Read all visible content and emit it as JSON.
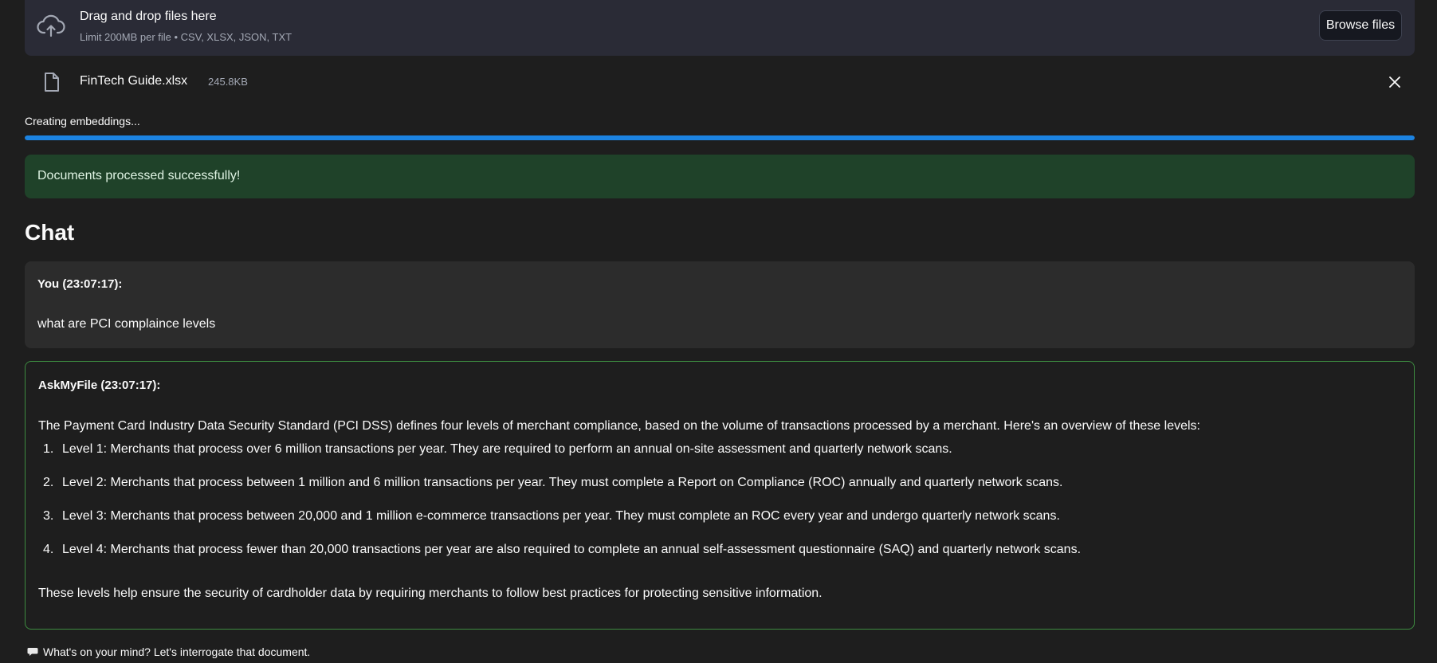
{
  "uploader": {
    "title": "Drag and drop files here",
    "limit": "Limit 200MB per file • CSV, XLSX, JSON, TXT",
    "browse_label": "Browse files",
    "icon": "cloud-upload-icon"
  },
  "file": {
    "name": "FinTech Guide.xlsx",
    "size": "245.8KB",
    "icon": "file-icon",
    "remove_icon": "close-icon"
  },
  "progress": {
    "label": "Creating embeddings...",
    "value": 1.0,
    "color": "#1c83e1"
  },
  "alert": {
    "text": "Documents processed successfully!",
    "color": "#1f4229"
  },
  "chat": {
    "title": "Chat",
    "messages": [
      {
        "author": "You (23:07:17):",
        "text": "what are PCI complaince levels"
      },
      {
        "author": "AskMyFile (23:07:17):",
        "intro": "The Payment Card Industry Data Security Standard (PCI DSS) defines four levels of merchant compliance, based on the volume of transactions processed by a merchant. Here's an overview of these levels:",
        "items": [
          {
            "num": "1.",
            "text": "Level 1: Merchants that process over 6 million transactions per year. They are required to perform an annual on-site assessment and quarterly network scans."
          },
          {
            "num": "2.",
            "text": "Level 2: Merchants that process between 1 million and 6 million transactions per year. They must complete a Report on Compliance (ROC) annually and quarterly network scans."
          },
          {
            "num": "3.",
            "text": "Level 3: Merchants that process between 20,000 and 1 million e-commerce transactions per year. They must complete an ROC every year and undergo quarterly network scans."
          },
          {
            "num": "4.",
            "text": "Level 4: Merchants that process fewer than 20,000 transactions per year are also required to complete an annual self-assessment questionnaire (SAQ) and quarterly network scans."
          }
        ],
        "outro": "These levels help ensure the security of cardholder data by requiring merchants to follow best practices for protecting sensitive information."
      }
    ],
    "input_placeholder": "What's on your mind? Let's interrogate that document."
  }
}
